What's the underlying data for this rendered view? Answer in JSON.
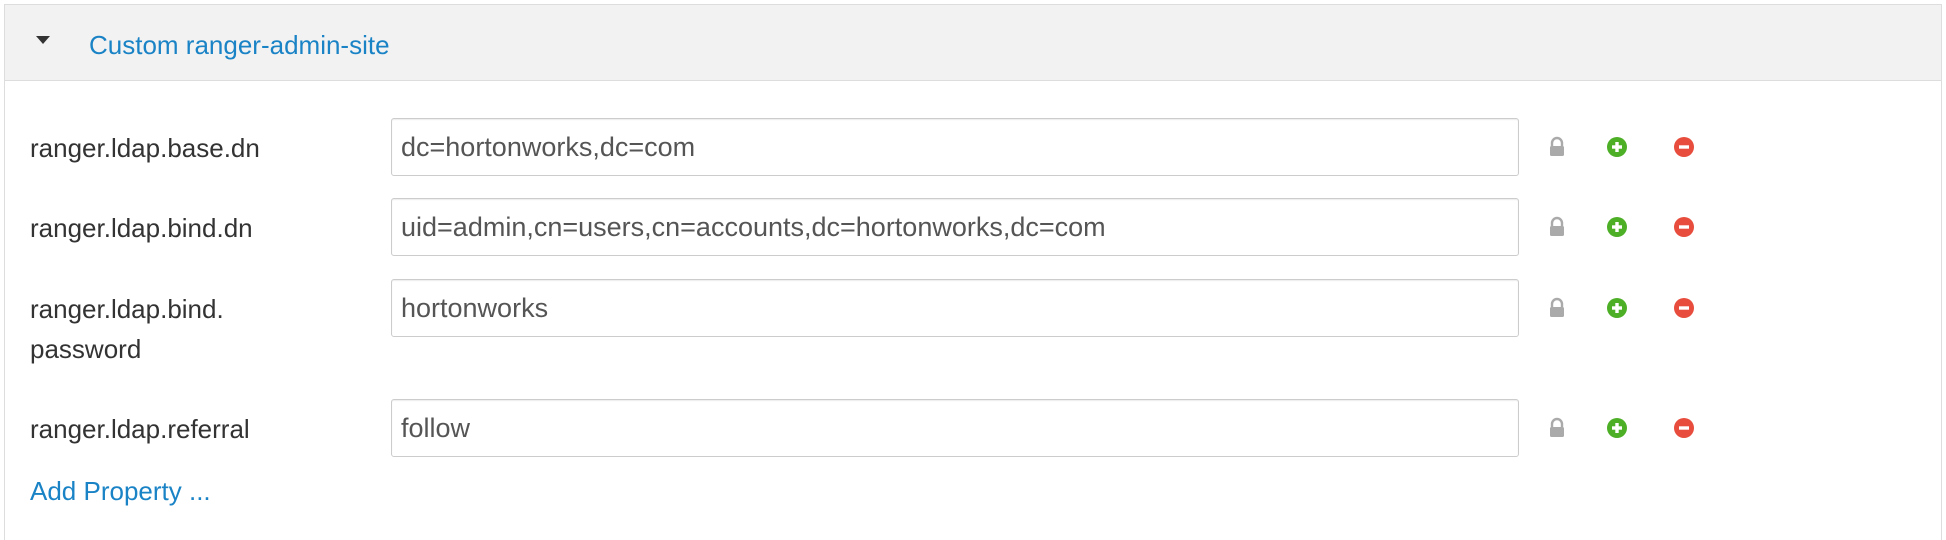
{
  "section": {
    "title": "Custom ranger-admin-site",
    "expanded": true
  },
  "properties": [
    {
      "label": "ranger.ldap.base.dn",
      "value": "dc=hortonworks,dc=com"
    },
    {
      "label": "ranger.ldap.bind.dn",
      "value": "uid=admin,cn=users,cn=accounts,dc=hortonworks,dc=com"
    },
    {
      "label": "ranger.ldap.bind.\npassword",
      "value": "hortonworks"
    },
    {
      "label": "ranger.ldap.referral",
      "value": "follow"
    }
  ],
  "actions": {
    "add_property": "Add Property ..."
  },
  "icons": {
    "lock": "lock-icon",
    "add": "plus-circle-icon",
    "remove": "minus-circle-icon"
  },
  "colors": {
    "link": "#1a83c6",
    "add": "#4caf26",
    "remove": "#e74c3c",
    "lock": "#aaaaaa"
  }
}
